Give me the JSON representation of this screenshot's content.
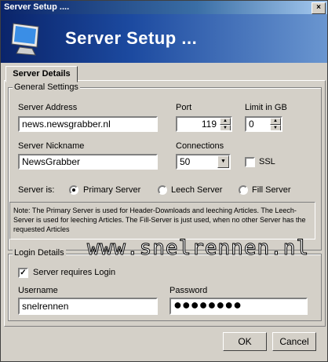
{
  "window": {
    "title": "Server Setup ....",
    "close_glyph": "×"
  },
  "banner": {
    "title": "Server Setup ...",
    "icon": "monitor-icon"
  },
  "tabs": [
    {
      "label": "Server Details"
    }
  ],
  "general": {
    "group_label": "General Settings",
    "server_address": {
      "label": "Server Address",
      "value": "news.newsgrabber.nl"
    },
    "port": {
      "label": "Port",
      "value": "119"
    },
    "limit": {
      "label": "Limit in GB",
      "value": "0"
    },
    "nickname": {
      "label": "Server Nickname",
      "value": "NewsGrabber"
    },
    "connections": {
      "label": "Connections",
      "value": "50"
    },
    "ssl": {
      "label": "SSL",
      "checked": false
    },
    "server_is": {
      "label": "Server is:",
      "options": [
        "Primary Server",
        "Leech Server",
        "Fill Server"
      ],
      "selected": "Primary Server"
    },
    "note": "Note: The Primary Server is used for Header-Downloads and leeching Articles. The Leech-Server is used for leeching Articles. The Fill-Server is just used, when no other Server has the requested Articles"
  },
  "login": {
    "group_label": "Login Details",
    "requires_login": {
      "label": "Server requires Login",
      "checked": true
    },
    "username": {
      "label": "Username",
      "value": "snelrennen"
    },
    "password": {
      "label": "Password",
      "masked": "●●●●●●●●"
    }
  },
  "watermark": "www.snelrennen.nl",
  "buttons": {
    "ok": "OK",
    "cancel": "Cancel"
  },
  "colors": {
    "banner": "#1c4aa0",
    "face": "#d4d0c8"
  }
}
